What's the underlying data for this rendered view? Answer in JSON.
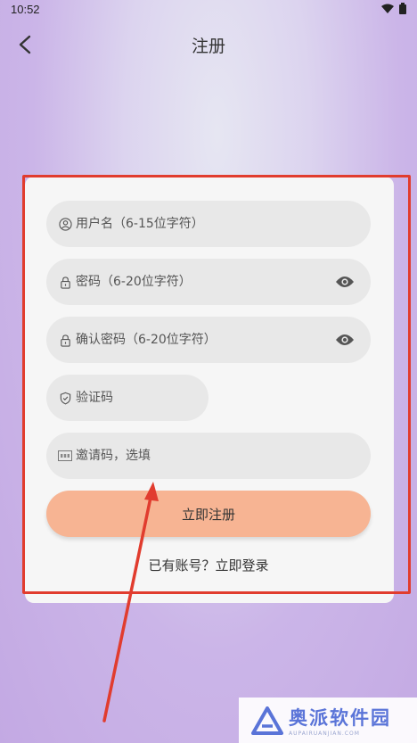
{
  "status_bar": {
    "time": "10:52"
  },
  "header": {
    "title": "注册"
  },
  "form": {
    "username_placeholder": "用户名（6-15位字符）",
    "password_placeholder": "密码（6-20位字符）",
    "confirm_placeholder": "确认密码（6-20位字符）",
    "captcha_placeholder": "验证码",
    "invite_placeholder": "邀请码，选填",
    "submit_label": "立即注册"
  },
  "footer": {
    "has_account_text": "已有账号？",
    "login_link": "立即登录"
  },
  "watermark": {
    "brand": "奥派软件园",
    "sub": "AUPAIRUANJIAN.COM"
  },
  "colors": {
    "accent": "#f7b493",
    "annotation": "#e13c2e"
  }
}
